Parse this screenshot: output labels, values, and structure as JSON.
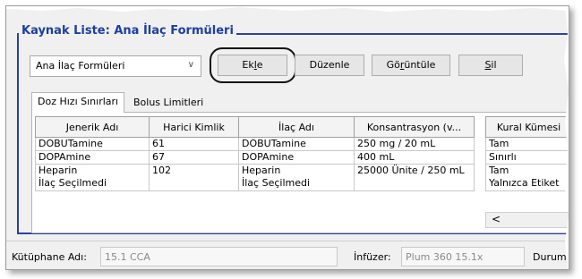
{
  "group_title": "Kaynak Liste: Ana İlaç Formüleri",
  "formulary_dropdown": {
    "value": "Ana İlaç Formüleri"
  },
  "toolbar": {
    "add_label_pre": "Ek",
    "add_label_ul": "l",
    "add_label_post": "e",
    "edit_label": "Düzenle",
    "view_label_pre": "Gö",
    "view_label_ul": "r",
    "view_label_post": "üntüle",
    "delete_label_ul": "S",
    "delete_label_post": "il"
  },
  "tabs": [
    {
      "label": "Doz Hızı Sınırları",
      "active": true
    },
    {
      "label": "Bolus Limitleri",
      "active": false
    }
  ],
  "table": {
    "columns": [
      "Jenerik Adı",
      "Harici Kimlik",
      "İlaç Adı",
      "Konsantrasyon (v..."
    ],
    "rows": [
      {
        "generic": "DOBUTamine",
        "ext_id": "61",
        "drug": "DOBUTamine",
        "conc": "250 mg / 20 mL"
      },
      {
        "generic": "DOPAmine",
        "ext_id": "67",
        "drug": "DOPAmine",
        "conc": "400 mL"
      },
      {
        "generic": "Heparin",
        "generic2": "İlaç Seçilmedi",
        "ext_id": "102",
        "drug": "Heparin",
        "drug2": "İlaç Seçilmedi",
        "conc": "25000 Ünite / 250 mL"
      }
    ]
  },
  "rule_table": {
    "column": "Kural Kümesi",
    "rows": [
      "Tam",
      "Sınırlı",
      "Tam",
      "Yalnızca Etiket"
    ],
    "scroll_left_glyph": "<"
  },
  "statusbar": {
    "library_label": "Kütüphane Adı:",
    "library_value": "15.1 CCA",
    "infuser_label": "İnfüzer:",
    "infuser_value": "Plum 360 15.1x",
    "state_label": "Durum:"
  }
}
